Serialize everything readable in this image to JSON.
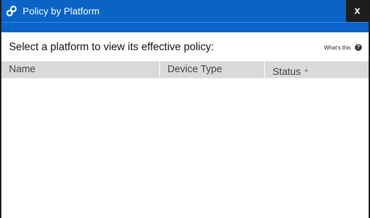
{
  "dialog": {
    "title": "Policy by Platform",
    "close_label": "x"
  },
  "prompt": "Select a platform to view its effective policy:",
  "help": {
    "label": "What's this",
    "icon_glyph": "?"
  },
  "table": {
    "columns": [
      {
        "label": "Name"
      },
      {
        "label": "Device Type"
      },
      {
        "label": "Status",
        "sort": "ascending"
      }
    ],
    "rows": []
  },
  "colors": {
    "titlebar": "#0a64c8",
    "close_button": "#1e1e1e",
    "header_bg": "#d9d9d9"
  },
  "icons": {
    "title": "policy-link-icon",
    "help": "question-circle-icon",
    "sort": "sort-ascending-icon"
  }
}
